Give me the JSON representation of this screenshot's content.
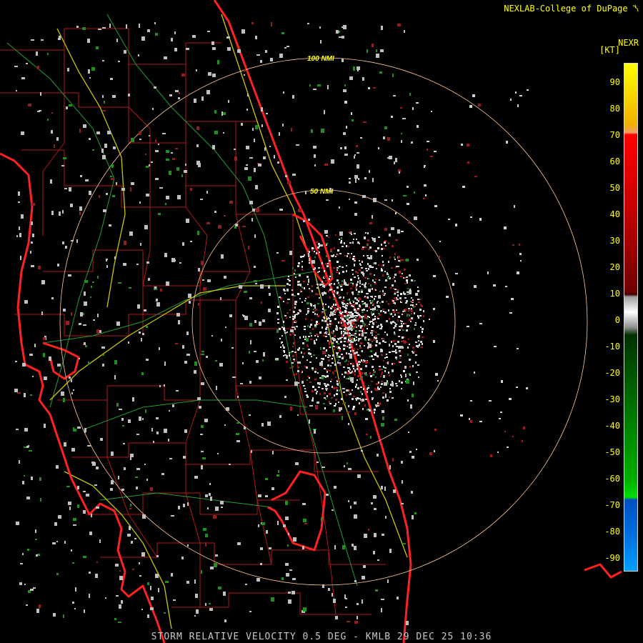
{
  "header": {
    "credit": "NEXLAB-College of DuPage",
    "logo_icon": "nexlab-logo-icon"
  },
  "legend": {
    "product": "NEXR",
    "units": "[KT]",
    "ticks": [
      "90",
      "80",
      "70",
      "60",
      "50",
      "40",
      "30",
      "20",
      "10",
      "0",
      "-10",
      "-20",
      "-30",
      "-40",
      "-50",
      "-60",
      "-70",
      "-80",
      "-90"
    ],
    "colors": {
      "top": "#ffff00",
      "orange": "#f0a060",
      "red": "#ff0000",
      "darkred": "#700000",
      "gray": "#909090",
      "darkgreen": "#005000",
      "green": "#00dd00",
      "blue": "#0050c0",
      "cyan": "#00a0ff"
    }
  },
  "map": {
    "range_rings": [
      {
        "label": "100 NMI",
        "radius_nmi": 100
      },
      {
        "label": "50 NMI",
        "radius_nmi": 50
      }
    ],
    "colors": {
      "coast": "#ff2020",
      "county": "#b01818",
      "road": "#c8c800",
      "highway": "#20a030",
      "ring": "#ffc896"
    }
  },
  "footer": {
    "caption": "STORM RELATIVE VELOCITY 0.5 DEG - KMLB 29 DEC 25 10:36"
  }
}
